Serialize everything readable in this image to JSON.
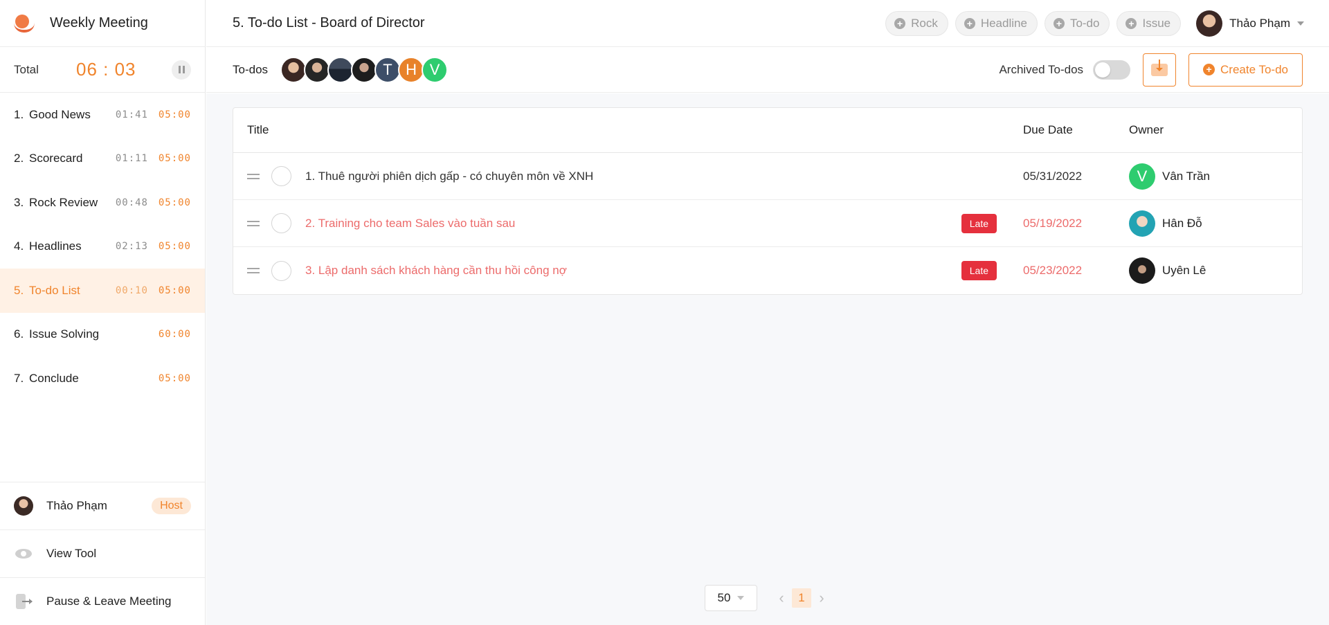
{
  "app": {
    "title": "Weekly Meeting"
  },
  "timer": {
    "label": "Total",
    "value": "06 : 03"
  },
  "agenda": [
    {
      "num": "1.",
      "name": "Good News",
      "used": "01:41",
      "limit": "05:00",
      "active": false
    },
    {
      "num": "2.",
      "name": "Scorecard",
      "used": "01:11",
      "limit": "05:00",
      "active": false
    },
    {
      "num": "3.",
      "name": "Rock Review",
      "used": "00:48",
      "limit": "05:00",
      "active": false
    },
    {
      "num": "4.",
      "name": "Headlines",
      "used": "02:13",
      "limit": "05:00",
      "active": false
    },
    {
      "num": "5.",
      "name": "To-do List",
      "used": "00:10",
      "limit": "05:00",
      "active": true
    },
    {
      "num": "6.",
      "name": "Issue Solving",
      "used": "",
      "limit": "60:00",
      "active": false
    },
    {
      "num": "7.",
      "name": "Conclude",
      "used": "",
      "limit": "05:00",
      "active": false
    }
  ],
  "sidebar_bottom": {
    "host_name": "Thảo Phạm",
    "host_badge": "Host",
    "view_tool": "View Tool",
    "leave": "Pause & Leave Meeting"
  },
  "header": {
    "page_title": "5. To-do List - Board of Director",
    "quick_adds": [
      "Rock",
      "Headline",
      "To-do",
      "Issue"
    ],
    "user_name": "Thảo Phạm"
  },
  "toolbar": {
    "section_label": "To-dos",
    "participant_initials": [
      "",
      "",
      "",
      "",
      "T",
      "H",
      "V"
    ],
    "archived_label": "Archived To-dos",
    "create_label": "Create To-do"
  },
  "table": {
    "columns": {
      "title": "Title",
      "due": "Due Date",
      "owner": "Owner"
    },
    "rows": [
      {
        "title": "1. Thuê người phiên dịch gấp - có chuyên môn về XNH",
        "late": false,
        "badge": "",
        "due": "05/31/2022",
        "owner": "Vân Trần",
        "owner_initial": "V"
      },
      {
        "title": "2. Training cho team Sales vào tuần sau",
        "late": true,
        "badge": "Late",
        "due": "05/19/2022",
        "owner": "Hân Đỗ",
        "owner_initial": ""
      },
      {
        "title": "3. Lập danh sách khách hàng cần thu hồi công nợ",
        "late": true,
        "badge": "Late",
        "due": "05/23/2022",
        "owner": "Uyên Lê",
        "owner_initial": ""
      }
    ]
  },
  "pagination": {
    "page_size": "50",
    "current_page": "1"
  },
  "colors": {
    "accent": "#f0842c",
    "late": "#e5303d",
    "late_text": "#ec6b6b"
  }
}
